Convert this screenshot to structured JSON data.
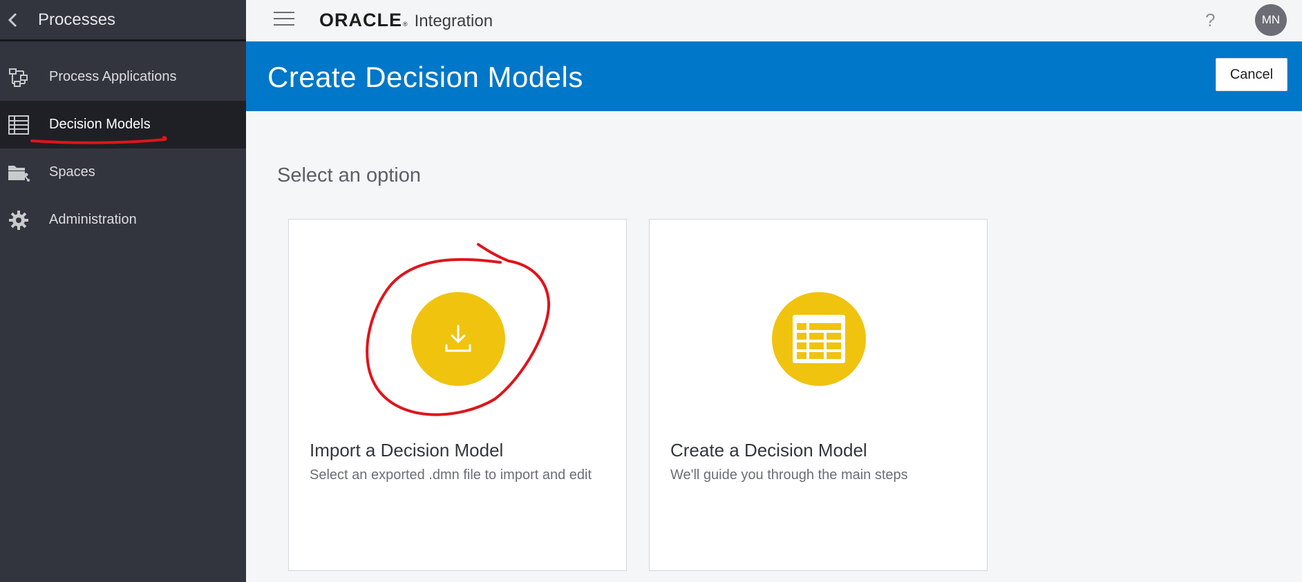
{
  "sidebar": {
    "title": "Processes",
    "items": [
      {
        "label": "Process Applications",
        "icon": "process-flow-icon"
      },
      {
        "label": "Decision Models",
        "icon": "table-grid-icon",
        "active": true
      },
      {
        "label": "Spaces",
        "icon": "spaces-folder-icon"
      },
      {
        "label": "Administration",
        "icon": "gear-icon"
      }
    ]
  },
  "topbar": {
    "brand": "ORACLE",
    "product": "Integration",
    "help": "?",
    "avatar": "MN"
  },
  "page": {
    "title": "Create Decision Models",
    "cancel_label": "Cancel"
  },
  "main": {
    "heading": "Select an option",
    "cards": [
      {
        "title": "Import a Decision Model",
        "description": "Select an exported .dmn file to import and edit",
        "icon": "download-icon"
      },
      {
        "title": "Create a Decision Model",
        "description": "We'll guide you through the main steps",
        "icon": "table-icon"
      }
    ]
  },
  "colors": {
    "sidebar_bg": "#33353e",
    "active_item_bg": "#1f2025",
    "band_blue": "#0077c8",
    "icon_yellow": "#f0c30f",
    "annotation_red": "#e0141b"
  }
}
